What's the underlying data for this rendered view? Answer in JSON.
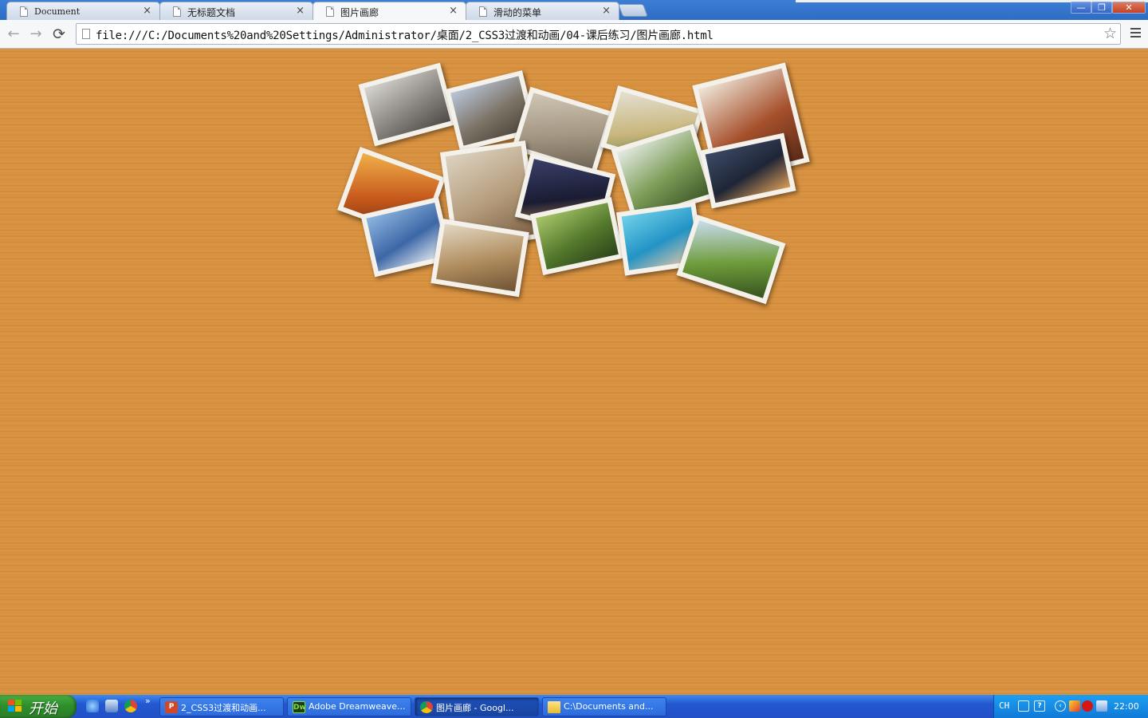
{
  "browser": {
    "tabs": [
      {
        "label": "Document",
        "close": "×",
        "active": false
      },
      {
        "label": "无标题文档",
        "close": "×",
        "active": false
      },
      {
        "label": "图片画廊",
        "close": "×",
        "active": true
      },
      {
        "label": "滑动的菜单",
        "close": "×",
        "active": false
      }
    ],
    "window_buttons": {
      "minimize": "—",
      "maximize": "❐",
      "close": "✕"
    },
    "nav": {
      "back": "←",
      "forward": "→",
      "reload": "⟳"
    },
    "address": "file:///C:/Documents%20and%20Settings/Administrator/桌面/2_CSS3过渡和动画/04-课后练习/图片画廊.html",
    "bookmark_star": "☆"
  },
  "gallery": {
    "background_color": "#d8913f",
    "photos": [
      {
        "subject": "misty-mountain-coast",
        "colors": [
          "#d8d6d2",
          "#8b8782",
          "#4e4a47"
        ]
      },
      {
        "subject": "great-wall",
        "colors": [
          "#b9c6d9",
          "#7d7468",
          "#4b4237"
        ]
      },
      {
        "subject": "rock-garden",
        "colors": [
          "#cfc6b4",
          "#a49783",
          "#6f6555"
        ]
      },
      {
        "subject": "seafood-dish",
        "colors": [
          "#e4e0d2",
          "#c8b67c",
          "#5e7d42"
        ]
      },
      {
        "subject": "stir-fry-dish",
        "colors": [
          "#efe6d8",
          "#a6502c",
          "#5a2a16"
        ]
      },
      {
        "subject": "shrimp-dish",
        "colors": [
          "#f0b04a",
          "#c75a1c",
          "#7a2e10"
        ]
      },
      {
        "subject": "mediterranean-arch-statue",
        "colors": [
          "#dcd2c0",
          "#b59c7c",
          "#7d6246"
        ]
      },
      {
        "subject": "city-night-tower",
        "colors": [
          "#3a3f68",
          "#1a1c33",
          "#c89a56"
        ]
      },
      {
        "subject": "willow-tree-lake",
        "colors": [
          "#e6ece7",
          "#7d9d58",
          "#3f5a2a"
        ]
      },
      {
        "subject": "city-skyline-night",
        "colors": [
          "#3c4a66",
          "#1f2536",
          "#d79b56"
        ]
      },
      {
        "subject": "santorini-domes",
        "colors": [
          "#8fb5e0",
          "#3c67a6",
          "#e9eef4"
        ]
      },
      {
        "subject": "colosseum",
        "colors": [
          "#e3d8c4",
          "#b08d5e",
          "#6e5234"
        ]
      },
      {
        "subject": "bamboo-forest",
        "colors": [
          "#a8c66a",
          "#54792c",
          "#2c441a"
        ]
      },
      {
        "subject": "swimmer-pool",
        "colors": [
          "#6fd0ea",
          "#2293c5",
          "#e7c7a8"
        ]
      },
      {
        "subject": "green-meadow-hills",
        "colors": [
          "#c9dcef",
          "#6e9c3b",
          "#36531e"
        ]
      }
    ]
  },
  "taskbar": {
    "start_label": "开始",
    "quick_launch_more": "»",
    "tasks": [
      {
        "label": "2_CSS3过渡和动画...",
        "icon": "P",
        "icon_name": "powerpoint-icon",
        "active": false
      },
      {
        "label": "Adobe Dreamweave...",
        "icon": "Dw",
        "icon_name": "dreamweaver-icon",
        "active": false
      },
      {
        "label": "图片画廊 - Googl...",
        "icon": "",
        "icon_name": "chrome-icon",
        "active": true
      },
      {
        "label": "C:\\Documents and...",
        "icon": "",
        "icon_name": "folder-icon",
        "active": false
      }
    ],
    "tray": {
      "language": "CH",
      "clock": "22:00"
    }
  }
}
